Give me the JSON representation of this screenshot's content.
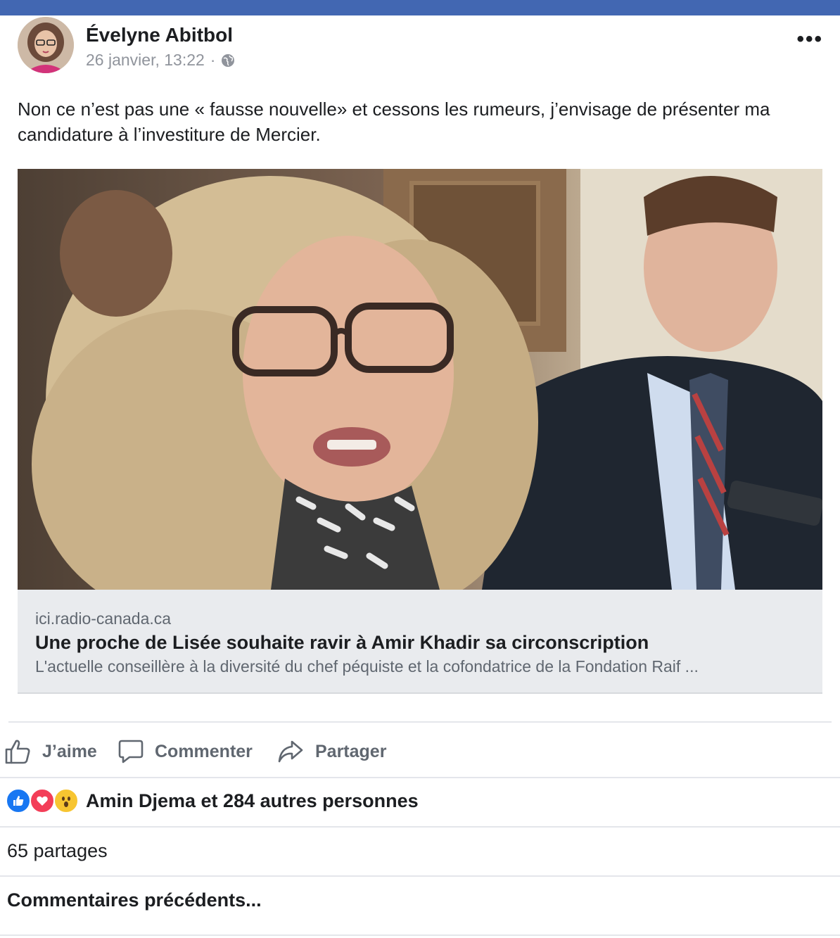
{
  "post": {
    "author": "Évelyne Abitbol",
    "timestamp": "26 janvier, 13:22",
    "separator": "·",
    "privacy_icon": "globe-icon",
    "more_label": "•••",
    "text": "Non ce n’est pas une « fausse nouvelle» et cessons les rumeurs, j’envisage de présenter ma candidature à l’investiture de Mercier."
  },
  "link": {
    "domain": "ici.radio-canada.ca",
    "title": "Une proche de Lisée souhaite ravir à Amir Khadir sa circonscription",
    "description": "L'actuelle conseillère à la diversité du chef péquiste et la cofondatrice de la Fondation Raif ..."
  },
  "actions": {
    "like": "J’aime",
    "comment": "Commenter",
    "share": "Partager"
  },
  "reactions": {
    "icons": [
      "like-icon",
      "love-icon",
      "wow-icon"
    ],
    "summary": "Amin Djema et 284 autres personnes"
  },
  "shares": "65 partages",
  "previous_comments": "Commentaires précédents..."
}
